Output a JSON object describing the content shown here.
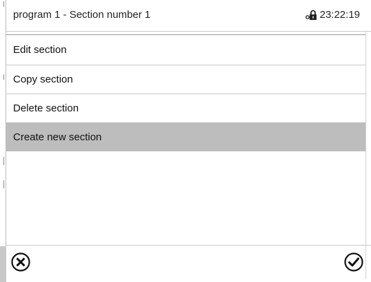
{
  "header": {
    "title": "program 1 - Section number 1",
    "time": "23:22:19",
    "lock_icon": "lock-key-icon"
  },
  "menu": {
    "items": [
      {
        "label": "Edit section",
        "selected": false
      },
      {
        "label": "Copy section",
        "selected": false
      },
      {
        "label": "Delete section",
        "selected": false
      },
      {
        "label": "Create new section",
        "selected": true
      }
    ]
  },
  "footer": {
    "cancel_icon": "circle-x-icon",
    "confirm_icon": "circle-check-icon"
  },
  "colors": {
    "selected_bg": "#bdbdbd",
    "border": "#c9c9c9",
    "text": "#111111"
  }
}
